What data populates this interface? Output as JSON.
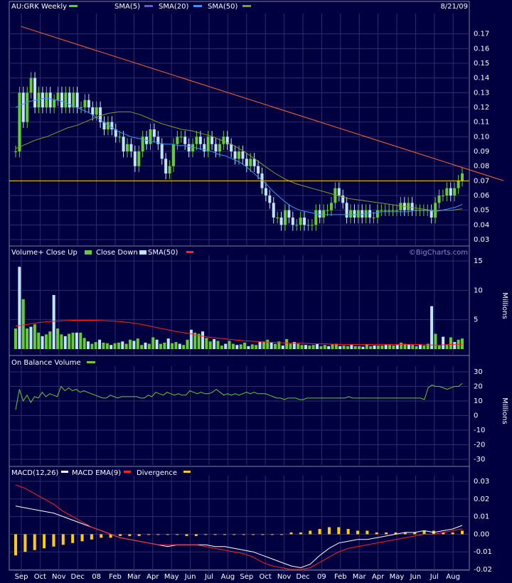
{
  "header": {
    "symbol_label": "AU:GRK Weekly",
    "date": "8/21/09",
    "legend": [
      {
        "label": "SMA(5)",
        "color": "#6a5acd"
      },
      {
        "label": "SMA(20)",
        "color": "#3399ff"
      },
      {
        "label": "SMA(50)",
        "color": "#8a9a2a"
      }
    ],
    "symbol_color": "#66cc33"
  },
  "volume_header": {
    "items": [
      {
        "label": "Volume+ Close Up",
        "color": "#66cc33"
      },
      {
        "label": "Close Down",
        "color": "#bfe6ff"
      },
      {
        "label": "SMA(50)",
        "color": "#ff2020"
      }
    ],
    "watermark": "©BigCharts.com",
    "unit_label": "Millions"
  },
  "obv_header": {
    "label": "On Balance Volume",
    "color": "#66cc33",
    "unit_label": "Millions"
  },
  "macd_header": {
    "items": [
      {
        "label": "MACD(12,26)",
        "color": "#ffffff"
      },
      {
        "label": "MACD EMA(9)",
        "color": "#ff2020"
      },
      {
        "label": "Divergence",
        "color": "#ffcc00"
      }
    ]
  },
  "x_axis": {
    "labels": [
      "Sep",
      "Oct",
      "Nov",
      "Dec",
      "08",
      "Feb",
      "Mar",
      "Apr",
      "May",
      "Jun",
      "Jul",
      "Aug",
      "Sep",
      "Oct",
      "Nov",
      "Dec",
      "09",
      "Feb",
      "Mar",
      "Apr",
      "May",
      "Jun",
      "Jul",
      "Aug"
    ]
  },
  "colors": {
    "background": "#000040",
    "grid": "#2e2e6a",
    "candle_up": "#66cc33",
    "candle_down": "#bfe6ff",
    "trendline": "#ff6633",
    "support": "#ffcc00"
  },
  "chart_data": [
    {
      "type": "candlestick",
      "title": "AU:GRK Weekly",
      "ylim": [
        0.03,
        0.18
      ],
      "y_ticks": [
        0.03,
        0.04,
        0.05,
        0.06,
        0.07,
        0.08,
        0.09,
        0.1,
        0.11,
        0.12,
        0.13,
        0.14,
        0.15,
        0.16,
        0.17
      ],
      "close": [
        0.09,
        0.13,
        0.11,
        0.13,
        0.14,
        0.12,
        0.13,
        0.12,
        0.13,
        0.12,
        0.125,
        0.13,
        0.12,
        0.13,
        0.12,
        0.13,
        0.12,
        0.12,
        0.125,
        0.12,
        0.115,
        0.12,
        0.11,
        0.105,
        0.11,
        0.105,
        0.1,
        0.1,
        0.09,
        0.095,
        0.09,
        0.08,
        0.09,
        0.1,
        0.095,
        0.105,
        0.1,
        0.095,
        0.085,
        0.075,
        0.08,
        0.095,
        0.1,
        0.1,
        0.095,
        0.09,
        0.095,
        0.1,
        0.095,
        0.09,
        0.1,
        0.095,
        0.09,
        0.095,
        0.1,
        0.095,
        0.09,
        0.085,
        0.09,
        0.085,
        0.08,
        0.085,
        0.08,
        0.075,
        0.065,
        0.06,
        0.055,
        0.045,
        0.045,
        0.04,
        0.05,
        0.045,
        0.04,
        0.04,
        0.045,
        0.04,
        0.04,
        0.04,
        0.05,
        0.045,
        0.05,
        0.05,
        0.055,
        0.065,
        0.06,
        0.055,
        0.045,
        0.05,
        0.045,
        0.05,
        0.045,
        0.05,
        0.045,
        0.045,
        0.05,
        0.05,
        0.05,
        0.05,
        0.05,
        0.05,
        0.055,
        0.05,
        0.055,
        0.05,
        0.05,
        0.05,
        0.05,
        0.05,
        0.045,
        0.055,
        0.06,
        0.06,
        0.065,
        0.06,
        0.065,
        0.07,
        0.075
      ],
      "series": [
        {
          "name": "SMA(20)",
          "values": [
            0.12,
            0.122,
            0.124,
            0.125,
            0.126,
            0.126,
            0.125,
            0.124,
            0.122,
            0.12,
            0.118,
            0.116,
            0.113,
            0.11,
            0.107,
            0.104,
            0.102,
            0.1,
            0.099,
            0.098,
            0.097,
            0.096,
            0.095,
            0.095,
            0.094,
            0.094,
            0.093,
            0.092,
            0.091,
            0.09,
            0.088,
            0.087,
            0.085,
            0.083,
            0.08,
            0.076,
            0.072,
            0.068,
            0.063,
            0.059,
            0.055,
            0.052,
            0.05,
            0.049,
            0.048,
            0.047,
            0.047,
            0.047,
            0.047,
            0.047,
            0.047,
            0.047,
            0.048,
            0.048,
            0.049,
            0.049,
            0.049,
            0.049,
            0.049,
            0.05,
            0.05,
            0.05,
            0.049,
            0.05,
            0.051,
            0.052,
            0.054
          ]
        },
        {
          "name": "SMA(50)",
          "values": [
            0.092,
            0.095,
            0.098,
            0.1,
            0.103,
            0.106,
            0.108,
            0.111,
            0.114,
            0.116,
            0.117,
            0.117,
            0.115,
            0.112,
            0.109,
            0.107,
            0.105,
            0.104,
            0.102,
            0.1,
            0.097,
            0.094,
            0.09,
            0.085,
            0.08,
            0.075,
            0.071,
            0.068,
            0.066,
            0.064,
            0.062,
            0.06,
            0.058,
            0.057,
            0.056,
            0.055,
            0.054,
            0.053,
            0.052,
            0.051,
            0.05,
            0.05,
            0.05,
            0.051
          ]
        },
        {
          "name": "Trend",
          "values": [
            0.175,
            0.075
          ]
        },
        {
          "name": "Support",
          "values": [
            0.07,
            0.07
          ]
        }
      ]
    },
    {
      "type": "bar",
      "title": "Volume+ Close Up  Close Down  SMA(50)",
      "ylabel": "Millions",
      "ylim": [
        0,
        15
      ],
      "y_ticks": [
        5,
        10,
        15
      ],
      "values": [
        3.5,
        14,
        8.5,
        3.5,
        3.8,
        4.2,
        2.8,
        2.2,
        2.5,
        3.0,
        9.2,
        3.5,
        2.5,
        2.2,
        2.6,
        2.8,
        2.8,
        2.8,
        1.9,
        1.3,
        0.9,
        1.2,
        1.6,
        1.1,
        1.0,
        0.7,
        1.0,
        1.1,
        1.3,
        0.9,
        1.6,
        1.4,
        1.8,
        0.7,
        1.1,
        0.9,
        2.0,
        1.6,
        0.9,
        1.1,
        1.8,
        1.0,
        1.2,
        0.9,
        0.7,
        1.6,
        3.3,
        2.8,
        2.6,
        3.0,
        1.9,
        1.3,
        1.7,
        1.4,
        0.6,
        0.9,
        1.4,
        0.9,
        0.7,
        0.8,
        1.1,
        0.5,
        0.8,
        0.7,
        1.2,
        1.3,
        1.6,
        1.1,
        0.9,
        1.3,
        0.6,
        1.7,
        0.9,
        1.2,
        0.9,
        0.7,
        0.7,
        0.6,
        0.7,
        0.9,
        0.5,
        0.7,
        0.5,
        0.8,
        0.9,
        0.5,
        0.6,
        0.5,
        0.7,
        0.5,
        0.5,
        0.4,
        0.8,
        0.5,
        0.6,
        0.6,
        0.6,
        0.7,
        0.7,
        0.6,
        0.7,
        1.1,
        0.9,
        0.8,
        0.7,
        0.5,
        0.8,
        0.6,
        0.9,
        7.3,
        2.6,
        0.6,
        2.1,
        0.7,
        2.0,
        1.2,
        1.6,
        1.8
      ],
      "series": [
        {
          "name": "SMA(50)",
          "values": [
            3.9,
            4.2,
            4.5,
            4.7,
            4.8,
            4.9,
            4.9,
            4.9,
            4.8,
            4.7,
            4.5,
            4.2,
            3.8,
            3.4,
            3.0,
            2.7,
            2.3,
            2.0,
            1.8,
            1.6,
            1.4,
            1.3,
            1.2,
            1.1,
            1.0,
            1.0,
            0.9,
            0.9,
            0.8,
            0.8,
            0.8,
            0.8,
            0.8,
            0.8,
            0.8,
            0.8,
            0.7,
            0.7,
            0.8,
            0.8
          ]
        }
      ],
      "colors": "up=#66cc33 down=#bfe6ff"
    },
    {
      "type": "line",
      "title": "On Balance Volume",
      "ylabel": "Millions",
      "ylim": [
        -30,
        30
      ],
      "y_ticks": [
        -30,
        -20,
        -10,
        0,
        10,
        20,
        30
      ],
      "values": [
        4,
        18,
        10,
        14,
        9,
        13,
        12,
        16,
        13,
        15,
        14,
        13,
        20,
        17,
        19,
        17,
        18,
        16,
        17,
        16,
        15,
        14,
        13,
        12,
        12,
        14,
        13,
        12,
        13,
        13,
        13,
        13,
        13,
        12,
        12,
        14,
        13,
        16,
        15,
        14,
        16,
        15,
        14,
        15,
        14,
        14,
        17,
        16,
        15,
        16,
        15,
        15,
        16,
        18,
        16,
        14,
        15,
        14,
        15,
        14,
        15,
        16,
        15,
        16,
        15,
        15,
        15,
        14,
        13,
        12,
        12,
        11,
        12,
        12,
        12,
        11,
        11,
        12,
        12,
        12,
        12,
        12,
        12,
        12,
        12,
        12,
        12,
        12,
        13,
        12,
        12,
        12,
        12,
        12,
        12,
        12,
        12,
        12,
        12,
        12,
        12,
        12,
        12,
        12,
        12,
        12,
        12,
        12,
        11,
        19,
        21,
        20,
        20,
        19,
        18,
        19,
        20,
        20,
        22
      ]
    },
    {
      "type": "line",
      "title": "MACD(12,26)  MACD EMA(9)  Divergence",
      "ylim": [
        -0.02,
        0.03
      ],
      "y_ticks": [
        -0.02,
        -0.01,
        0.0,
        0.01,
        0.02,
        0.03
      ],
      "series": [
        {
          "name": "MACD(12,26)",
          "values": [
            0.016,
            0.015,
            0.014,
            0.013,
            0.012,
            0.01,
            0.008,
            0.006,
            0.004,
            0.002,
            0.0,
            -0.002,
            -0.003,
            -0.004,
            -0.005,
            -0.006,
            -0.007,
            -0.006,
            -0.006,
            -0.006,
            -0.006,
            -0.007,
            -0.007,
            -0.008,
            -0.009,
            -0.01,
            -0.012,
            -0.014,
            -0.016,
            -0.018,
            -0.019,
            -0.017,
            -0.012,
            -0.008,
            -0.005,
            -0.004,
            -0.003,
            -0.003,
            -0.002,
            -0.001,
            0.0,
            0.001,
            0.001,
            0.002,
            0.001,
            0.002,
            0.003,
            0.005
          ]
        },
        {
          "name": "MACD EMA(9)",
          "values": [
            0.028,
            0.026,
            0.023,
            0.02,
            0.017,
            0.013,
            0.01,
            0.007,
            0.004,
            0.002,
            0.0,
            -0.002,
            -0.003,
            -0.004,
            -0.005,
            -0.006,
            -0.006,
            -0.006,
            -0.006,
            -0.006,
            -0.007,
            -0.008,
            -0.009,
            -0.01,
            -0.011,
            -0.013,
            -0.016,
            -0.018,
            -0.019,
            -0.02,
            -0.02,
            -0.019,
            -0.016,
            -0.013,
            -0.01,
            -0.008,
            -0.007,
            -0.006,
            -0.005,
            -0.004,
            -0.003,
            -0.002,
            -0.001,
            0.0,
            0.0,
            0.001,
            0.002,
            0.003
          ]
        },
        {
          "name": "Divergence",
          "values": [
            -0.012,
            -0.01,
            -0.009,
            -0.008,
            -0.007,
            -0.006,
            -0.005,
            -0.004,
            -0.003,
            -0.002,
            -0.002,
            -0.001,
            -0.001,
            -0.001,
            0.0,
            0.0,
            0.0,
            0.0,
            -0.001,
            -0.001,
            0.0,
            0.0,
            0.0,
            0.0,
            0.0,
            0.0,
            0.0,
            0.0,
            0.0,
            0.001,
            0.001,
            0.002,
            0.003,
            0.004,
            0.004,
            0.003,
            0.002,
            0.002,
            0.001,
            0.001,
            0.001,
            0.001,
            0.001,
            0.002,
            0.002,
            0.001,
            0.001,
            0.002
          ]
        }
      ]
    }
  ]
}
